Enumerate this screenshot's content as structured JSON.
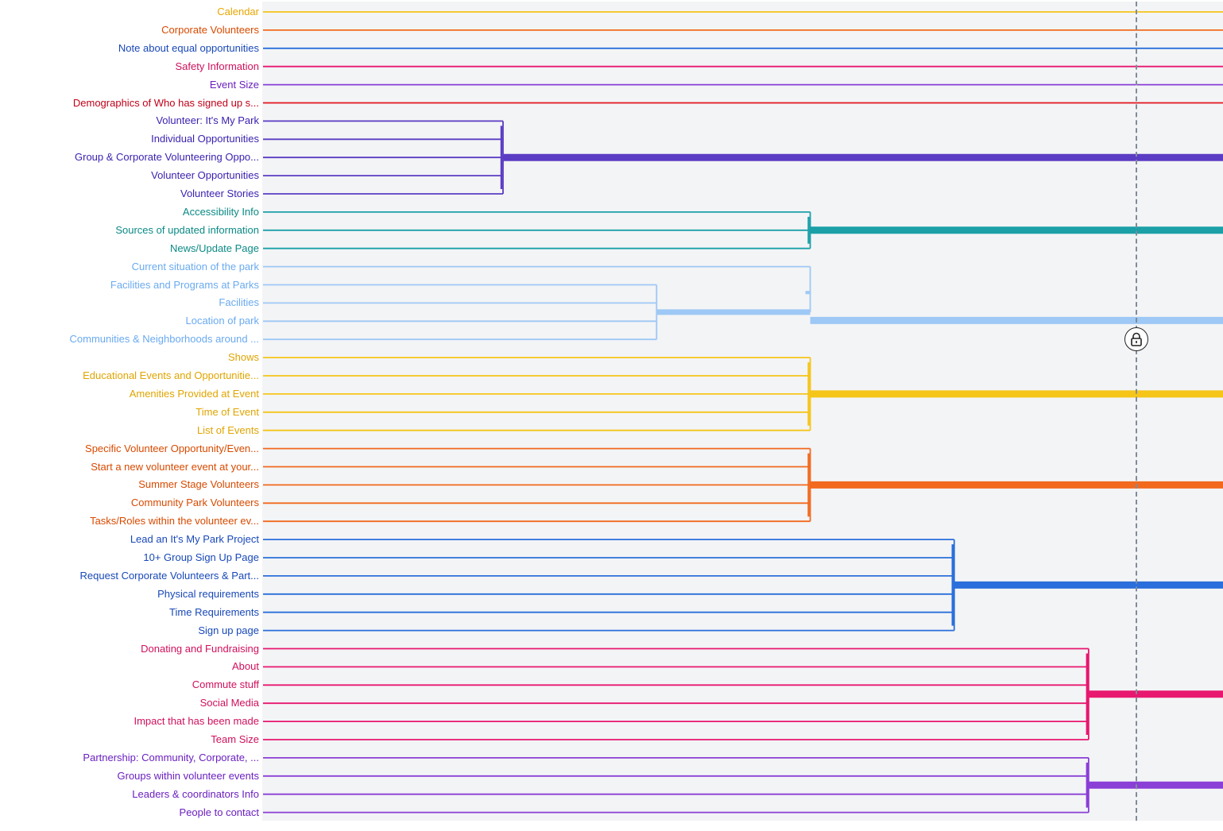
{
  "dendrogram": {
    "leaves": [
      {
        "label": "Calendar",
        "cluster": 0
      },
      {
        "label": "Corporate Volunteers",
        "cluster": 1
      },
      {
        "label": "Note about equal opportunities",
        "cluster": 2
      },
      {
        "label": "Safety Information",
        "cluster": 3
      },
      {
        "label": "Event Size",
        "cluster": 4
      },
      {
        "label": "Demographics of Who has signed up s...",
        "cluster": 5
      },
      {
        "label": "Volunteer: It's My Park",
        "cluster": 6
      },
      {
        "label": "Individual Opportunities",
        "cluster": 6
      },
      {
        "label": "Group & Corporate Volunteering Oppo...",
        "cluster": 6
      },
      {
        "label": "Volunteer Opportunities",
        "cluster": 6
      },
      {
        "label": "Volunteer Stories",
        "cluster": 6
      },
      {
        "label": "Accessibility Info",
        "cluster": 7
      },
      {
        "label": "Sources of updated information",
        "cluster": 7
      },
      {
        "label": "News/Update Page",
        "cluster": 7
      },
      {
        "label": "Current situation of the park",
        "cluster": 8
      },
      {
        "label": "Facilities and Programs at Parks",
        "cluster": 8
      },
      {
        "label": "Facilities",
        "cluster": 8
      },
      {
        "label": "Location of park",
        "cluster": 8
      },
      {
        "label": "Communities & Neighborhoods around ...",
        "cluster": 8
      },
      {
        "label": "Shows",
        "cluster": 9
      },
      {
        "label": "Educational Events and Opportunitie...",
        "cluster": 9
      },
      {
        "label": "Amenities Provided at Event",
        "cluster": 9
      },
      {
        "label": "Time of Event",
        "cluster": 9
      },
      {
        "label": "List of Events",
        "cluster": 9
      },
      {
        "label": "Specific Volunteer Opportunity/Even...",
        "cluster": 10
      },
      {
        "label": "Start a new volunteer event at your...",
        "cluster": 10
      },
      {
        "label": "Summer Stage Volunteers",
        "cluster": 10
      },
      {
        "label": "Community Park Volunteers",
        "cluster": 10
      },
      {
        "label": "Tasks/Roles within the volunteer ev...",
        "cluster": 10
      },
      {
        "label": "Lead an It's My Park Project",
        "cluster": 11
      },
      {
        "label": "10+ Group Sign Up Page",
        "cluster": 11
      },
      {
        "label": "Request Corporate Volunteers & Part...",
        "cluster": 11
      },
      {
        "label": "Physical requirements",
        "cluster": 11
      },
      {
        "label": "Time Requirements",
        "cluster": 11
      },
      {
        "label": "Sign up page",
        "cluster": 11
      },
      {
        "label": "Donating and Fundraising",
        "cluster": 12
      },
      {
        "label": "About",
        "cluster": 12
      },
      {
        "label": "Commute stuff",
        "cluster": 12
      },
      {
        "label": "Social Media",
        "cluster": 12
      },
      {
        "label": "Impact that has been made",
        "cluster": 12
      },
      {
        "label": "Team Size",
        "cluster": 12
      },
      {
        "label": "Partnership: Community, Corporate, ...",
        "cluster": 13
      },
      {
        "label": "Groups within volunteer events",
        "cluster": 13
      },
      {
        "label": "Leaders & coordinators Info",
        "cluster": 13
      },
      {
        "label": "People to contact",
        "cluster": 13
      }
    ],
    "clusters": [
      {
        "label_color": "#e6a700",
        "line_color": "#f5c518",
        "merge_level": null,
        "members": [
          0
        ]
      },
      {
        "label_color": "#d84a00",
        "line_color": "#f2691e",
        "merge_level": null,
        "members": [
          1
        ]
      },
      {
        "label_color": "#1848b8",
        "line_color": "#2a6fdb",
        "merge_level": null,
        "members": [
          2
        ]
      },
      {
        "label_color": "#d0105c",
        "line_color": "#e8176f",
        "merge_level": null,
        "members": [
          3
        ]
      },
      {
        "label_color": "#6a1fc0",
        "line_color": "#8a3fd6",
        "merge_level": null,
        "members": [
          4
        ]
      },
      {
        "label_color": "#c00018",
        "line_color": "#e1151e",
        "merge_level": null,
        "members": [
          5
        ]
      },
      {
        "label_color": "#3a1fb0",
        "line_color": "#5b3cc4",
        "merge_level": 0.25,
        "members": [
          6,
          7,
          8,
          9,
          10
        ]
      },
      {
        "label_color": "#0b8a86",
        "line_color": "#1ba0a8",
        "merge_level": 0.57,
        "members": [
          11,
          12,
          13
        ]
      },
      {
        "label_color": "#6aaaf0",
        "line_color": "#9ec8f5",
        "merge_level": 0.57,
        "sub_merge_level": 0.41,
        "members": [
          14,
          15,
          16,
          17,
          18
        ]
      },
      {
        "label_color": "#e0a500",
        "line_color": "#f5c518",
        "merge_level": 0.57,
        "members": [
          19,
          20,
          21,
          22,
          23
        ]
      },
      {
        "label_color": "#d84a00",
        "line_color": "#f2691e",
        "merge_level": 0.57,
        "members": [
          24,
          25,
          26,
          27,
          28
        ]
      },
      {
        "label_color": "#1848b8",
        "line_color": "#2a6fdb",
        "merge_level": 0.72,
        "members": [
          29,
          30,
          31,
          32,
          33,
          34
        ]
      },
      {
        "label_color": "#d0105c",
        "line_color": "#e8176f",
        "merge_level": 0.86,
        "members": [
          35,
          36,
          37,
          38,
          39,
          40
        ]
      },
      {
        "label_color": "#6a1fc0",
        "line_color": "#8a3fd6",
        "merge_level": 0.86,
        "members": [
          41,
          42,
          43,
          44
        ]
      }
    ],
    "cutoff_level": 0.91,
    "cutoff_locked": true
  },
  "icons": {
    "cutoff_handle": "lock-icon"
  }
}
